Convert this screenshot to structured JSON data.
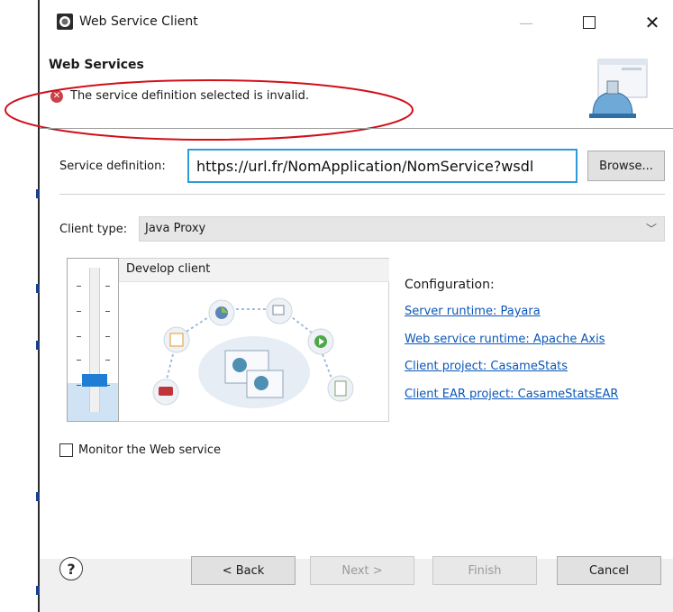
{
  "window": {
    "title": "Web Service Client"
  },
  "banner": {
    "title": "Web Services",
    "error_message": "The service definition selected is invalid."
  },
  "service_definition": {
    "label": "Service definition:",
    "value": "https://url.fr/NomApplication/NomService?wsdl",
    "browse_label": "Browse..."
  },
  "client_type": {
    "label": "Client type:",
    "selected": "Java Proxy"
  },
  "develop": {
    "title": "Develop client",
    "slider_level_fraction": 0.25
  },
  "configuration": {
    "title": "Configuration:",
    "links": [
      "Server runtime: Payara",
      "Web service runtime: Apache Axis",
      "Client project: CasameStats",
      "Client EAR project: CasameStatsEAR"
    ]
  },
  "monitor": {
    "label": "Monitor the Web service",
    "checked": false
  },
  "footer": {
    "help_symbol": "?",
    "back_label": "< Back",
    "next_label": "Next >",
    "finish_label": "Finish",
    "cancel_label": "Cancel"
  },
  "colors": {
    "accent_blue": "#2f9ad8",
    "link_blue": "#0b57b8",
    "error_red": "#c9424a",
    "annotation_red": "#d0101a"
  }
}
